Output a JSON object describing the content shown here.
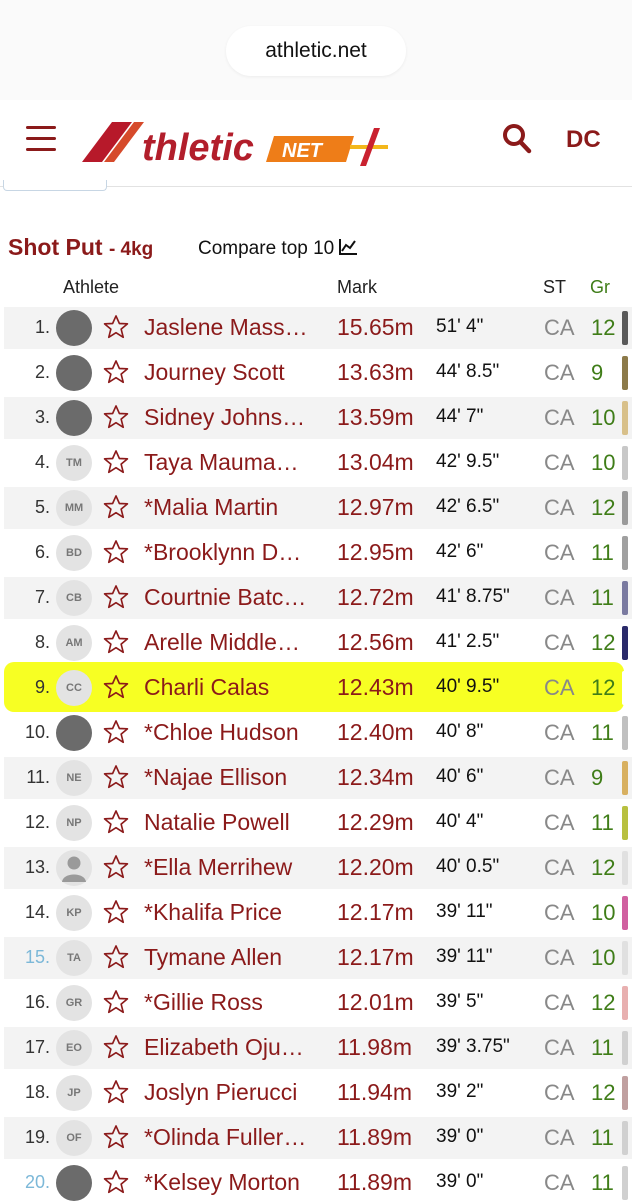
{
  "browser": {
    "url": "athletic.net"
  },
  "header": {
    "logo_text": "AthleticNET",
    "user_initials": "DC"
  },
  "event": {
    "title": "Shot Put",
    "subtitle": "- 4kg",
    "compare_label": "Compare top 10"
  },
  "columns": {
    "athlete": "Athlete",
    "mark": "Mark",
    "state": "ST",
    "grade": "Gr"
  },
  "colors": {
    "brand": "#8b1a1a",
    "grade_green": "#3f7d18",
    "highlight": "#f7ff23",
    "rank_link": "#7cb8d8"
  },
  "highlighted_rank": "9.",
  "rows": [
    {
      "rank": "1.",
      "avatar": "photo",
      "name": "Jaslene Mass…",
      "mark": "15.65m",
      "feet": "51' 4\"",
      "st": "CA",
      "gr": "12"
    },
    {
      "rank": "2.",
      "avatar": "photo",
      "name": "Journey Scott",
      "mark": "13.63m",
      "feet": "44' 8.5\"",
      "st": "CA",
      "gr": "9"
    },
    {
      "rank": "3.",
      "avatar": "photo",
      "name": "Sidney Johns…",
      "mark": "13.59m",
      "feet": "44' 7\"",
      "st": "CA",
      "gr": "10"
    },
    {
      "rank": "4.",
      "avatar": "TM",
      "name": "Taya Mauma…",
      "mark": "13.04m",
      "feet": "42' 9.5\"",
      "st": "CA",
      "gr": "10"
    },
    {
      "rank": "5.",
      "avatar": "MM",
      "name": "*Malia Martin",
      "mark": "12.97m",
      "feet": "42' 6.5\"",
      "st": "CA",
      "gr": "12"
    },
    {
      "rank": "6.",
      "avatar": "BD",
      "name": "*Brooklynn D…",
      "mark": "12.95m",
      "feet": "42' 6\"",
      "st": "CA",
      "gr": "11"
    },
    {
      "rank": "7.",
      "avatar": "CB",
      "name": "Courtnie Batc…",
      "mark": "12.72m",
      "feet": "41' 8.75\"",
      "st": "CA",
      "gr": "11"
    },
    {
      "rank": "8.",
      "avatar": "AM",
      "name": "Arelle Middle…",
      "mark": "12.56m",
      "feet": "41' 2.5\"",
      "st": "CA",
      "gr": "12"
    },
    {
      "rank": "9.",
      "avatar": "CC",
      "name": "Charli Calas",
      "mark": "12.43m",
      "feet": "40' 9.5\"",
      "st": "CA",
      "gr": "12"
    },
    {
      "rank": "10.",
      "avatar": "photo",
      "name": "*Chloe Hudson",
      "mark": "12.40m",
      "feet": "40' 8\"",
      "st": "CA",
      "gr": "11"
    },
    {
      "rank": "11.",
      "avatar": "NE",
      "name": "*Najae Ellison",
      "mark": "12.34m",
      "feet": "40' 6\"",
      "st": "CA",
      "gr": "9"
    },
    {
      "rank": "12.",
      "avatar": "NP",
      "name": "Natalie Powell",
      "mark": "12.29m",
      "feet": "40' 4\"",
      "st": "CA",
      "gr": "11"
    },
    {
      "rank": "13.",
      "avatar": "default",
      "name": "*Ella Merrihew",
      "mark": "12.20m",
      "feet": "40' 0.5\"",
      "st": "CA",
      "gr": "12"
    },
    {
      "rank": "14.",
      "avatar": "KP",
      "name": "*Khalifa Price",
      "mark": "12.17m",
      "feet": "39' 11\"",
      "st": "CA",
      "gr": "10"
    },
    {
      "rank": "15.",
      "avatar": "TA",
      "name": "Tymane Allen",
      "mark": "12.17m",
      "feet": "39' 11\"",
      "st": "CA",
      "gr": "10",
      "rank_style": "blue"
    },
    {
      "rank": "16.",
      "avatar": "GR",
      "name": "*Gillie Ross",
      "mark": "12.01m",
      "feet": "39' 5\"",
      "st": "CA",
      "gr": "12"
    },
    {
      "rank": "17.",
      "avatar": "EO",
      "name": "Elizabeth Oju…",
      "mark": "11.98m",
      "feet": "39' 3.75\"",
      "st": "CA",
      "gr": "11"
    },
    {
      "rank": "18.",
      "avatar": "JP",
      "name": "Joslyn Pierucci",
      "mark": "11.94m",
      "feet": "39' 2\"",
      "st": "CA",
      "gr": "12"
    },
    {
      "rank": "19.",
      "avatar": "OF",
      "name": "*Olinda Fuller…",
      "mark": "11.89m",
      "feet": "39' 0\"",
      "st": "CA",
      "gr": "11"
    },
    {
      "rank": "20.",
      "avatar": "photo",
      "name": "*Kelsey Morton",
      "mark": "11.89m",
      "feet": "39' 0\"",
      "st": "CA",
      "gr": "11",
      "rank_style": "blue"
    }
  ]
}
